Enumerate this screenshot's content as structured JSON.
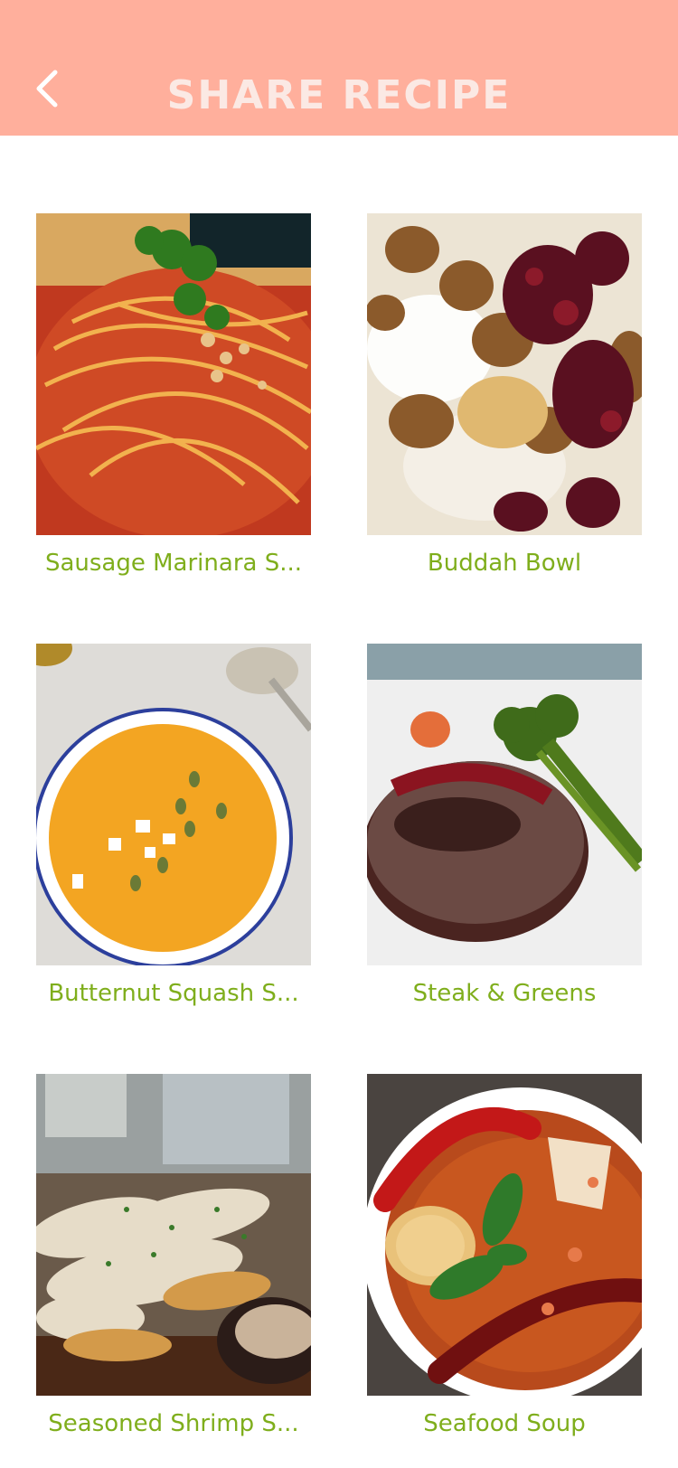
{
  "header": {
    "title": "SHARE RECIPE",
    "back_icon": "chevron-left-icon",
    "background": "#ffaf9c"
  },
  "recipes": [
    {
      "name": "Sausage Marinara S...",
      "photo": "spaghetti-marinara"
    },
    {
      "name": "Buddah Bowl",
      "photo": "nuts-cranberries-bowl"
    },
    {
      "name": "Butternut Squash S...",
      "photo": "squash-soup"
    },
    {
      "name": "Steak & Greens",
      "photo": "steak-broccolini"
    },
    {
      "name": "Seasoned Shrimp S...",
      "photo": "seasoned-shrimp"
    },
    {
      "name": "Seafood Soup",
      "photo": "red-curry-soup"
    }
  ],
  "colors": {
    "label": "#7fae1c",
    "title": "#fbe9e4"
  }
}
